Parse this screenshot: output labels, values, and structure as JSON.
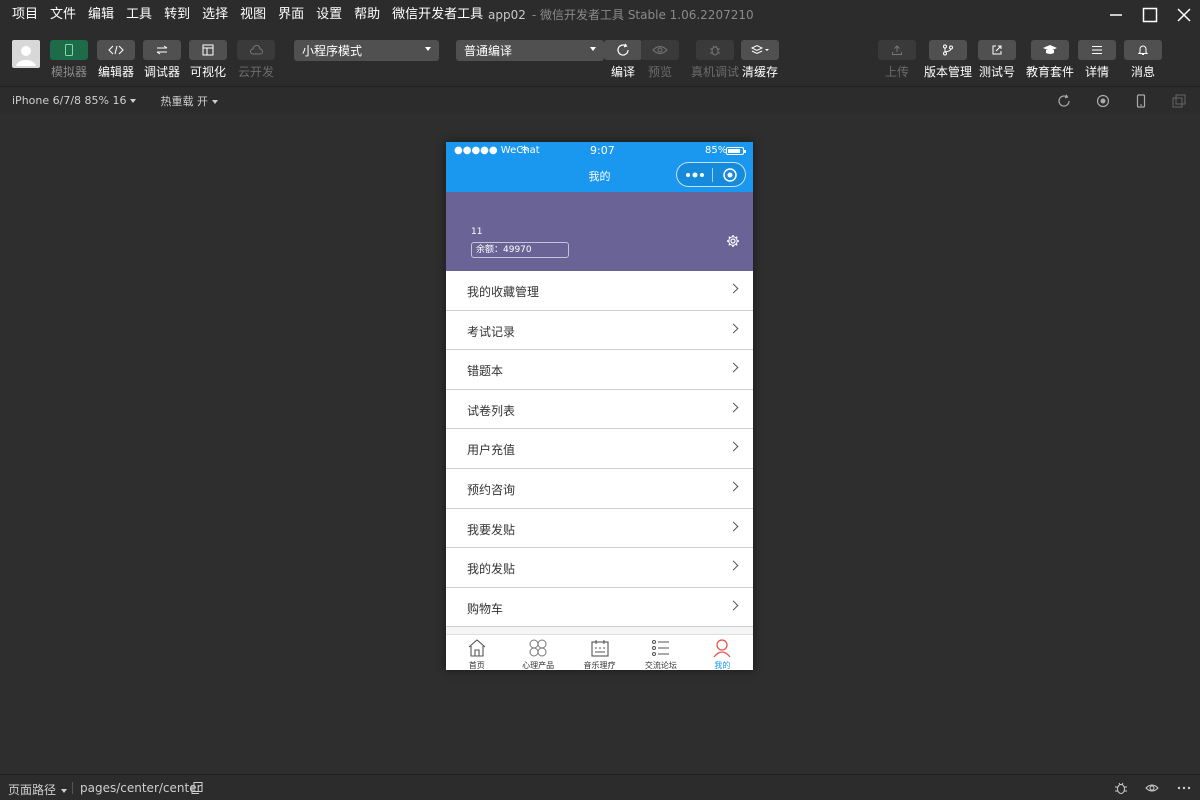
{
  "menubar": {
    "items": [
      "项目",
      "文件",
      "编辑",
      "工具",
      "转到",
      "选择",
      "视图",
      "界面",
      "设置",
      "帮助",
      "微信开发者工具"
    ],
    "project_name": "app02",
    "app_title": "- 微信开发者工具 Stable 1.06.2207210"
  },
  "toolbar": {
    "simulator": "模拟器",
    "editor": "编辑器",
    "debugger": "调试器",
    "visual": "可视化",
    "cloud": "云开发",
    "mode_select": "小程序模式",
    "compile_select": "普通编译",
    "compile": "编译",
    "preview": "预览",
    "remote_debug": "真机调试",
    "clear_cache": "清缓存",
    "upload": "上传",
    "version": "版本管理",
    "test_account": "测试号",
    "edu_kit": "教育套件",
    "details": "详情",
    "messages": "消息"
  },
  "devbar": {
    "device": "iPhone 6/7/8 85% 16",
    "hot_reload": "热重载 开"
  },
  "phone": {
    "carrier": "●●●●● WeChat",
    "time": "9:07",
    "battery": "85%",
    "battery_level": 0.85,
    "nav_title": "我的",
    "username": "11",
    "balance": "余额：49970",
    "menu": [
      "我的收藏管理",
      "考试记录",
      "错题本",
      "试卷列表",
      "用户充值",
      "预约咨询",
      "我要发贴",
      "我的发贴",
      "购物车"
    ],
    "tabs": [
      "首页",
      "心理产品",
      "音乐理疗",
      "交流论坛",
      "我的"
    ],
    "active_tab": "我的",
    "colors": {
      "nav": "#1a97ee",
      "profile": "#6a6496",
      "active_tab": "#1a97ee"
    }
  },
  "bottombar": {
    "path_label": "页面路径",
    "path": "pages/center/center"
  }
}
